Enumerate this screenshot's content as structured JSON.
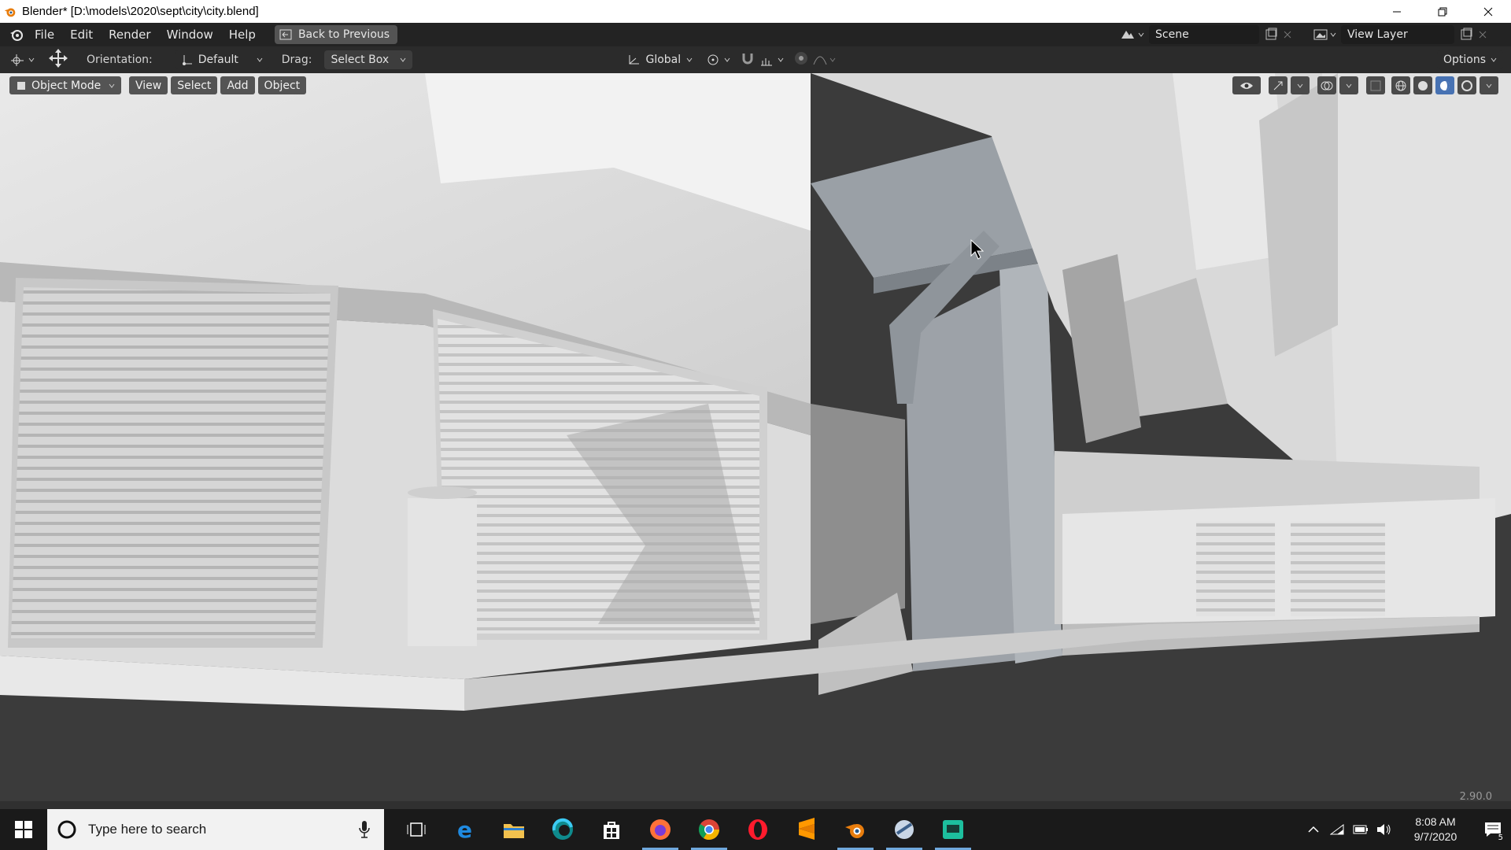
{
  "window": {
    "title": "Blender* [D:\\models\\2020\\sept\\city\\city.blend]"
  },
  "menubar": {
    "items": [
      "File",
      "Edit",
      "Render",
      "Window",
      "Help"
    ],
    "back_button": "Back to Previous",
    "scene_label": "Scene",
    "view_layer_label": "View Layer"
  },
  "toolheader": {
    "orientation_label": "Orientation:",
    "orientation_value": "Default",
    "drag_label": "Drag:",
    "drag_value": "Select Box",
    "transform_orientation": "Global",
    "options_label": "Options"
  },
  "viewport": {
    "mode": "Object Mode",
    "menu": [
      "View",
      "Select",
      "Add",
      "Object"
    ],
    "version": "2.90.0",
    "shading_active": "material-preview"
  },
  "taskbar": {
    "search_placeholder": "Type here to search",
    "apps": [
      "task-view",
      "edge-legacy",
      "file-explorer",
      "edge",
      "store",
      "firefox",
      "chrome",
      "opera",
      "sublime-text",
      "blender",
      "unknown-app",
      "terminal-app"
    ],
    "time": "8:08 AM",
    "date": "9/7/2020",
    "notification_count": "5"
  },
  "colors": {
    "accent": "#4772b3",
    "header": "#232323",
    "viewport_ground": "#3a3a3a"
  }
}
